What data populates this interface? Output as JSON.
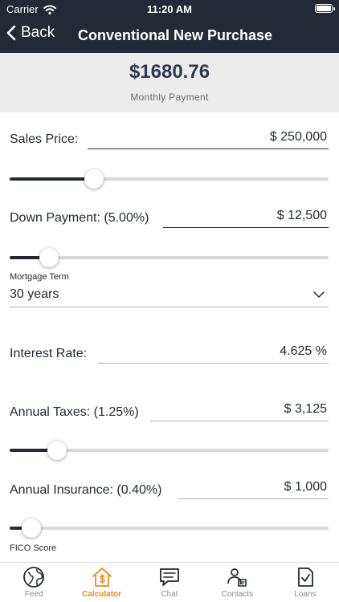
{
  "status_bar": {
    "carrier": "Carrier",
    "time": "11:20 AM"
  },
  "nav": {
    "back_label": "Back",
    "title": "Conventional New Purchase"
  },
  "summary": {
    "amount": "$1680.76",
    "label": "Monthly Payment"
  },
  "sales_price": {
    "label": "Sales Price:",
    "value": "$ 250,000",
    "slider_fraction": 0.25
  },
  "down_payment": {
    "label": "Down Payment: (5.00%)",
    "value": "$ 12,500",
    "slider_fraction": 0.1
  },
  "mortgage_term": {
    "label": "Mortgage Term",
    "selected": "30 years"
  },
  "interest_rate": {
    "label": "Interest Rate:",
    "value": "4.625 %"
  },
  "annual_taxes": {
    "label": "Annual Taxes: (1.25%)",
    "value": "$ 3,125",
    "slider_fraction": 0.125
  },
  "annual_insurance": {
    "label": "Annual Insurance: (0.40%)",
    "value": "$ 1,000",
    "slider_fraction": 0.04
  },
  "fico": {
    "label": "FICO Score"
  },
  "tabs": [
    {
      "label": "Feed",
      "icon": "globe-icon"
    },
    {
      "label": "Calculator",
      "icon": "house-dollar-icon",
      "active": true
    },
    {
      "label": "Chat",
      "icon": "chat-icon"
    },
    {
      "label": "Contacts",
      "icon": "contacts-icon"
    },
    {
      "label": "Loans",
      "icon": "document-check-icon"
    }
  ],
  "colors": {
    "header": "#232a35",
    "accent": "#e88a1a",
    "summary_bg": "#ececec",
    "amount": "#2e3a4b"
  }
}
